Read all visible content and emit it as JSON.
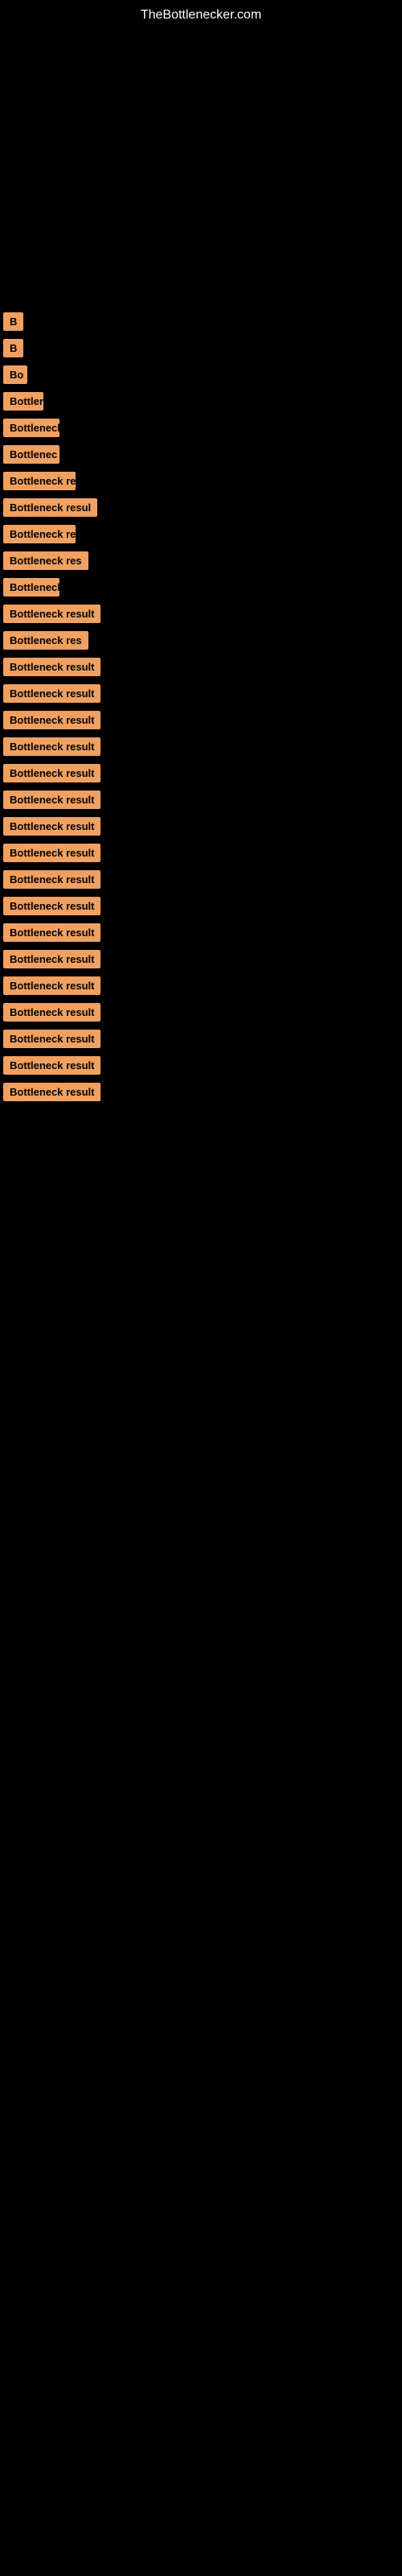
{
  "site": {
    "title": "TheBottlenecker.com"
  },
  "items": [
    {
      "id": 1,
      "label": "B",
      "width_class": "label-xs"
    },
    {
      "id": 2,
      "label": "B",
      "width_class": "label-xs"
    },
    {
      "id": 3,
      "label": "Bo",
      "width_class": "label-xs"
    },
    {
      "id": 4,
      "label": "Bottlen",
      "width_class": "label-sm"
    },
    {
      "id": 5,
      "label": "Bottleneck r",
      "width_class": "label-md"
    },
    {
      "id": 6,
      "label": "Bottlenec",
      "width_class": "label-md"
    },
    {
      "id": 7,
      "label": "Bottleneck re",
      "width_class": "label-lg"
    },
    {
      "id": 8,
      "label": "Bottleneck resul",
      "width_class": "label-xl"
    },
    {
      "id": 9,
      "label": "Bottleneck re",
      "width_class": "label-lg"
    },
    {
      "id": 10,
      "label": "Bottleneck res",
      "width_class": "label-xl"
    },
    {
      "id": 11,
      "label": "Bottleneck",
      "width_class": "label-md"
    },
    {
      "id": 12,
      "label": "Bottleneck result",
      "width_class": "label-full"
    },
    {
      "id": 13,
      "label": "Bottleneck res",
      "width_class": "label-xl"
    },
    {
      "id": 14,
      "label": "Bottleneck result",
      "width_class": "label-full"
    },
    {
      "id": 15,
      "label": "Bottleneck result",
      "width_class": "label-full"
    },
    {
      "id": 16,
      "label": "Bottleneck result",
      "width_class": "label-full"
    },
    {
      "id": 17,
      "label": "Bottleneck result",
      "width_class": "label-full"
    },
    {
      "id": 18,
      "label": "Bottleneck result",
      "width_class": "label-full"
    },
    {
      "id": 19,
      "label": "Bottleneck result",
      "width_class": "label-full"
    },
    {
      "id": 20,
      "label": "Bottleneck result",
      "width_class": "label-full"
    },
    {
      "id": 21,
      "label": "Bottleneck result",
      "width_class": "label-full"
    },
    {
      "id": 22,
      "label": "Bottleneck result",
      "width_class": "label-full"
    },
    {
      "id": 23,
      "label": "Bottleneck result",
      "width_class": "label-full"
    },
    {
      "id": 24,
      "label": "Bottleneck result",
      "width_class": "label-full"
    },
    {
      "id": 25,
      "label": "Bottleneck result",
      "width_class": "label-full"
    },
    {
      "id": 26,
      "label": "Bottleneck result",
      "width_class": "label-full"
    },
    {
      "id": 27,
      "label": "Bottleneck result",
      "width_class": "label-full"
    },
    {
      "id": 28,
      "label": "Bottleneck result",
      "width_class": "label-full"
    },
    {
      "id": 29,
      "label": "Bottleneck result",
      "width_class": "label-full"
    },
    {
      "id": 30,
      "label": "Bottleneck result",
      "width_class": "label-full"
    }
  ]
}
